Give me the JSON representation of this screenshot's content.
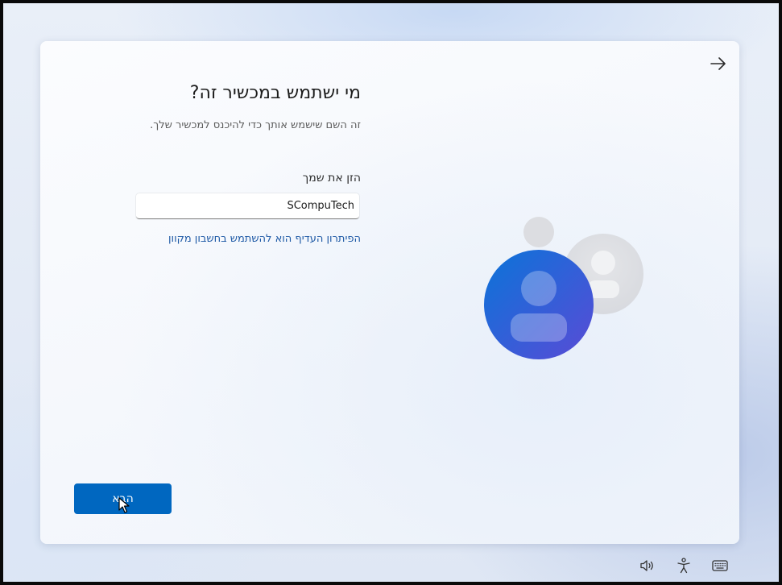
{
  "page": {
    "title": "מי ישתמש במכשיר זה?",
    "subtitle": "זה השם שישמש אותך כדי להיכנס למכשיר שלך.",
    "name_label": "הזן את שמך",
    "name_value": "SCompuTech",
    "online_account_link": "הפיתרון העדיף הוא להשתמש בחשבון מקוון",
    "next_button_label": "הבא"
  },
  "icons": {
    "nav_next": "arrow-right-icon",
    "illustration": "user-avatar-illustration",
    "tray": [
      "volume-icon",
      "accessibility-icon",
      "keyboard-icon"
    ]
  },
  "colors": {
    "accent": "#0067c0",
    "link": "#1f5aa6",
    "avatar_gradient_start": "#0a74d9",
    "avatar_gradient_end": "#5a4bd6"
  }
}
